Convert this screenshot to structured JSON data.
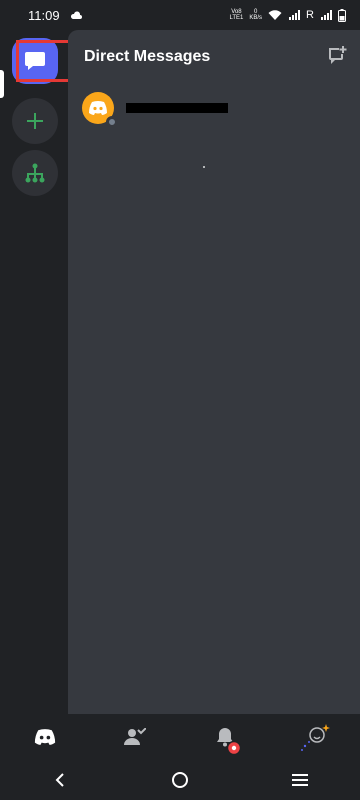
{
  "status_bar": {
    "time": "11:09",
    "network_top": "Vo8",
    "network_bottom": "LTE1",
    "speed_top": "0",
    "speed_bottom": "KB/s",
    "roaming": "R"
  },
  "panel": {
    "title": "Direct Messages"
  },
  "colors": {
    "accent": "#5865f2",
    "rail_bg": "#202225",
    "panel_bg": "#36393f",
    "highlight": "#e53935",
    "green": "#3ba55d"
  },
  "icons": {
    "dm": "chat-bubble-icon",
    "add": "plus-icon",
    "discover": "network-tree-icon",
    "new_dm": "new-message-icon",
    "home": "discord-logo-icon",
    "friends": "friends-icon",
    "notifications": "bell-icon",
    "profile": "avatar-icon"
  }
}
